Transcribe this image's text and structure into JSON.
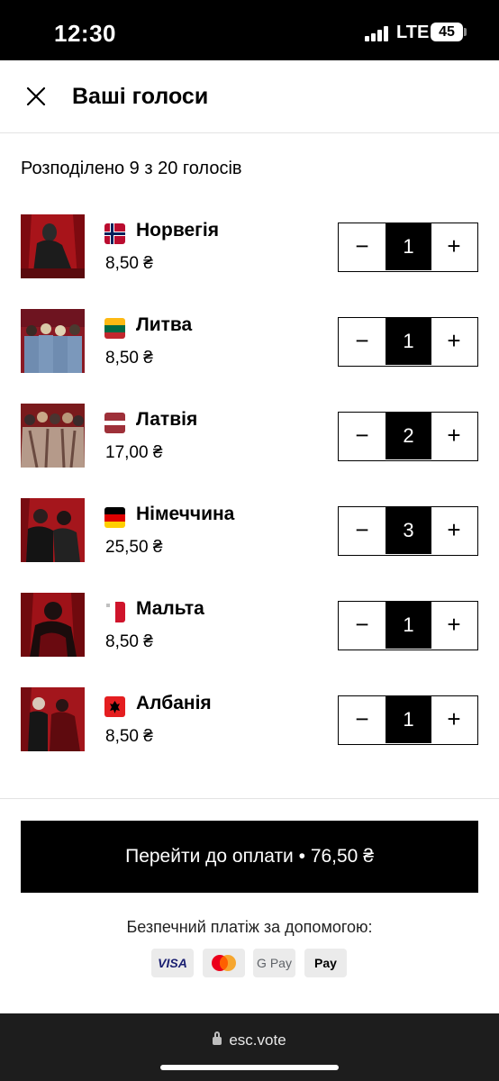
{
  "status_bar": {
    "time": "12:30",
    "network": "LTE",
    "battery": "45"
  },
  "header": {
    "title": "Ваші голоси",
    "close_icon": "close-icon"
  },
  "summary": "Розподілено 9 з 20 голосів",
  "votes": [
    {
      "country": "Норвегія",
      "price": "8,50 ₴",
      "count": "1",
      "flag": "norway-flag"
    },
    {
      "country": "Литва",
      "price": "8,50 ₴",
      "count": "1",
      "flag": "lithuania-flag"
    },
    {
      "country": "Латвія",
      "price": "17,00 ₴",
      "count": "2",
      "flag": "latvia-flag"
    },
    {
      "country": "Німеччина",
      "price": "25,50 ₴",
      "count": "3",
      "flag": "germany-flag"
    },
    {
      "country": "Мальта",
      "price": "8,50 ₴",
      "count": "1",
      "flag": "malta-flag"
    },
    {
      "country": "Албанія",
      "price": "8,50 ₴",
      "count": "1",
      "flag": "albania-flag"
    }
  ],
  "stepper": {
    "minus": "−",
    "plus": "+"
  },
  "checkout": {
    "label": "Перейти до оплати • 76,50 ₴"
  },
  "secure_payment": "Безпечний платіж за допомогою:",
  "payment_methods": {
    "visa": "VISA",
    "mastercard": "mastercard",
    "gpay": "G Pay",
    "applepay": " Pay"
  },
  "browser": {
    "url": "esc.vote"
  },
  "colors": {
    "primary": "#000000",
    "background": "#ffffff",
    "divider": "#e3e3e3",
    "badge": "#ebebeb"
  }
}
